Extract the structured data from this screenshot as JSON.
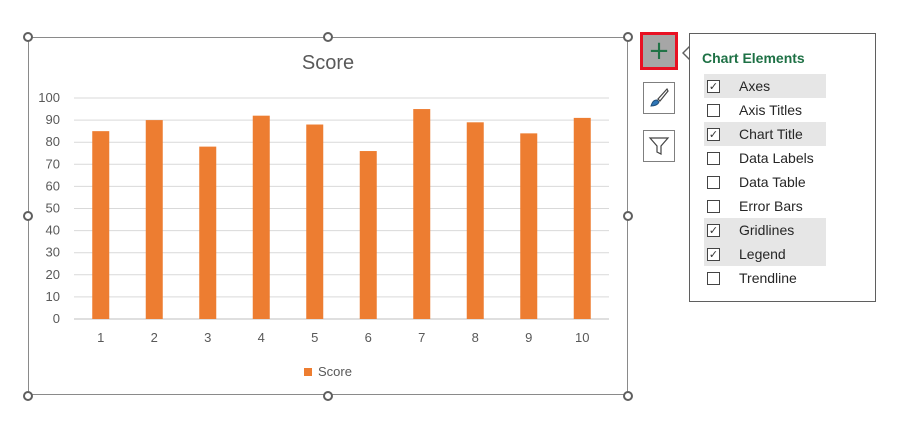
{
  "chart": {
    "title": "Score",
    "legend_label": "Score",
    "bar_color": "#ed7d31"
  },
  "chart_data": {
    "type": "bar",
    "title": "Score",
    "categories": [
      "1",
      "2",
      "3",
      "4",
      "5",
      "6",
      "7",
      "8",
      "9",
      "10"
    ],
    "series": [
      {
        "name": "Score",
        "values": [
          85,
          90,
          78,
          92,
          88,
          76,
          95,
          89,
          84,
          91
        ],
        "color": "#ed7d31"
      }
    ],
    "ylim": [
      0,
      100
    ],
    "yticks": [
      0,
      10,
      20,
      30,
      40,
      50,
      60,
      70,
      80,
      90,
      100
    ],
    "grid": true,
    "legend": "bottom"
  },
  "side_buttons": {
    "chart_elements": "plus-icon",
    "chart_styles": "paintbrush-icon",
    "chart_filters": "filter-icon"
  },
  "chart_elements_panel": {
    "title": "Chart Elements",
    "items": [
      {
        "label": "Axes",
        "checked": true
      },
      {
        "label": "Axis Titles",
        "checked": false
      },
      {
        "label": "Chart Title",
        "checked": true
      },
      {
        "label": "Data Labels",
        "checked": false
      },
      {
        "label": "Data Table",
        "checked": false
      },
      {
        "label": "Error Bars",
        "checked": false
      },
      {
        "label": "Gridlines",
        "checked": true
      },
      {
        "label": "Legend",
        "checked": true
      },
      {
        "label": "Trendline",
        "checked": false
      }
    ]
  }
}
